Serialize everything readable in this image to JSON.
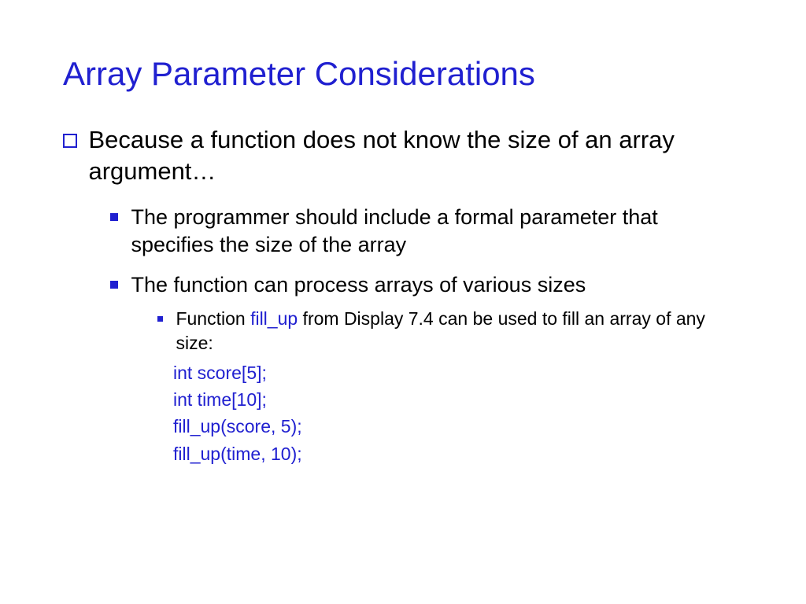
{
  "title": "Array Parameter Considerations",
  "level1": {
    "text": "Because a function does not know the size of an array argument…"
  },
  "level2a": {
    "text": "The programmer should include a formal parameter that specifies the size of the array"
  },
  "level2b": {
    "text": "The function can process arrays of various sizes"
  },
  "level3": {
    "prefix": "Function ",
    "keyword": "fill_up",
    "suffix": " from Display 7.4 can be used to fill an array of any size:"
  },
  "code": {
    "line1": "int score[5];",
    "line2": "int time[10];",
    "line3": "fill_up(score, 5);",
    "line4": "fill_up(time, 10);"
  }
}
